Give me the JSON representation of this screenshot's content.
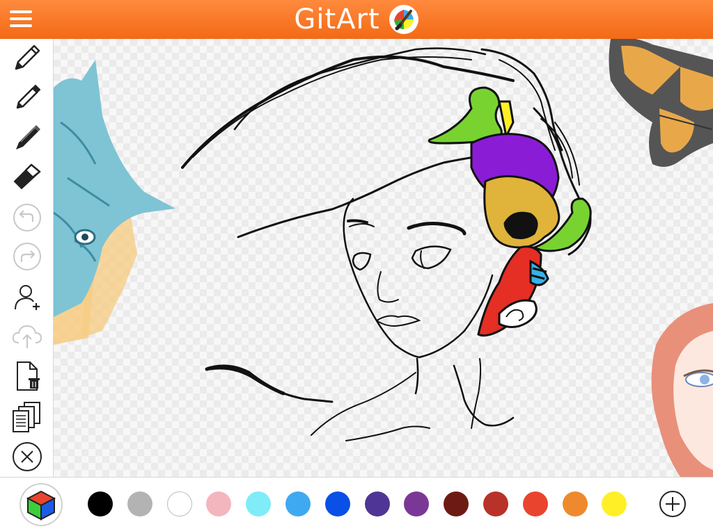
{
  "header": {
    "title": "GitArt",
    "menu_icon": "hamburger-menu-icon",
    "logo_icon": "paintbrush-logo-icon",
    "colors": {
      "bar": "#f36a16",
      "text": "#ffffff"
    }
  },
  "toolbar": {
    "tools": [
      {
        "name": "pencil-tool",
        "icon": "pencil-icon",
        "enabled": true
      },
      {
        "name": "pen-tool",
        "icon": "pen-icon",
        "enabled": true
      },
      {
        "name": "marker-tool",
        "icon": "marker-icon",
        "enabled": true
      },
      {
        "name": "eraser-tool",
        "icon": "eraser-icon",
        "enabled": true
      },
      {
        "name": "undo-button",
        "icon": "undo-icon",
        "enabled": false
      },
      {
        "name": "redo-button",
        "icon": "redo-icon",
        "enabled": false
      },
      {
        "name": "add-user-button",
        "icon": "add-user-icon",
        "enabled": true
      },
      {
        "name": "upload-cloud-button",
        "icon": "cloud-upload-icon",
        "enabled": false
      },
      {
        "name": "delete-page-button",
        "icon": "page-trash-icon",
        "enabled": true
      },
      {
        "name": "copy-pages-button",
        "icon": "pages-copy-icon",
        "enabled": true
      },
      {
        "name": "close-button",
        "icon": "close-circle-icon",
        "enabled": true
      }
    ]
  },
  "palette": {
    "picker_icon": "color-cube-icon",
    "add_icon": "plus-circle-icon",
    "colors": [
      "#000000",
      "#b3b3b3",
      "#ffffff",
      "#f4b6be",
      "#7fecf8",
      "#3ea9f0",
      "#0a4fe6",
      "#4f3596",
      "#7b3796",
      "#6e1a14",
      "#b8322a",
      "#e9442e",
      "#ee8a2d",
      "#ffef27"
    ]
  },
  "canvas": {
    "artwork": "line-art-girl-with-colored-hair",
    "background_stickers": [
      "blue-wolf-sticker",
      "monarch-butterfly-sticker",
      "red-haired-girl-sticker"
    ]
  }
}
